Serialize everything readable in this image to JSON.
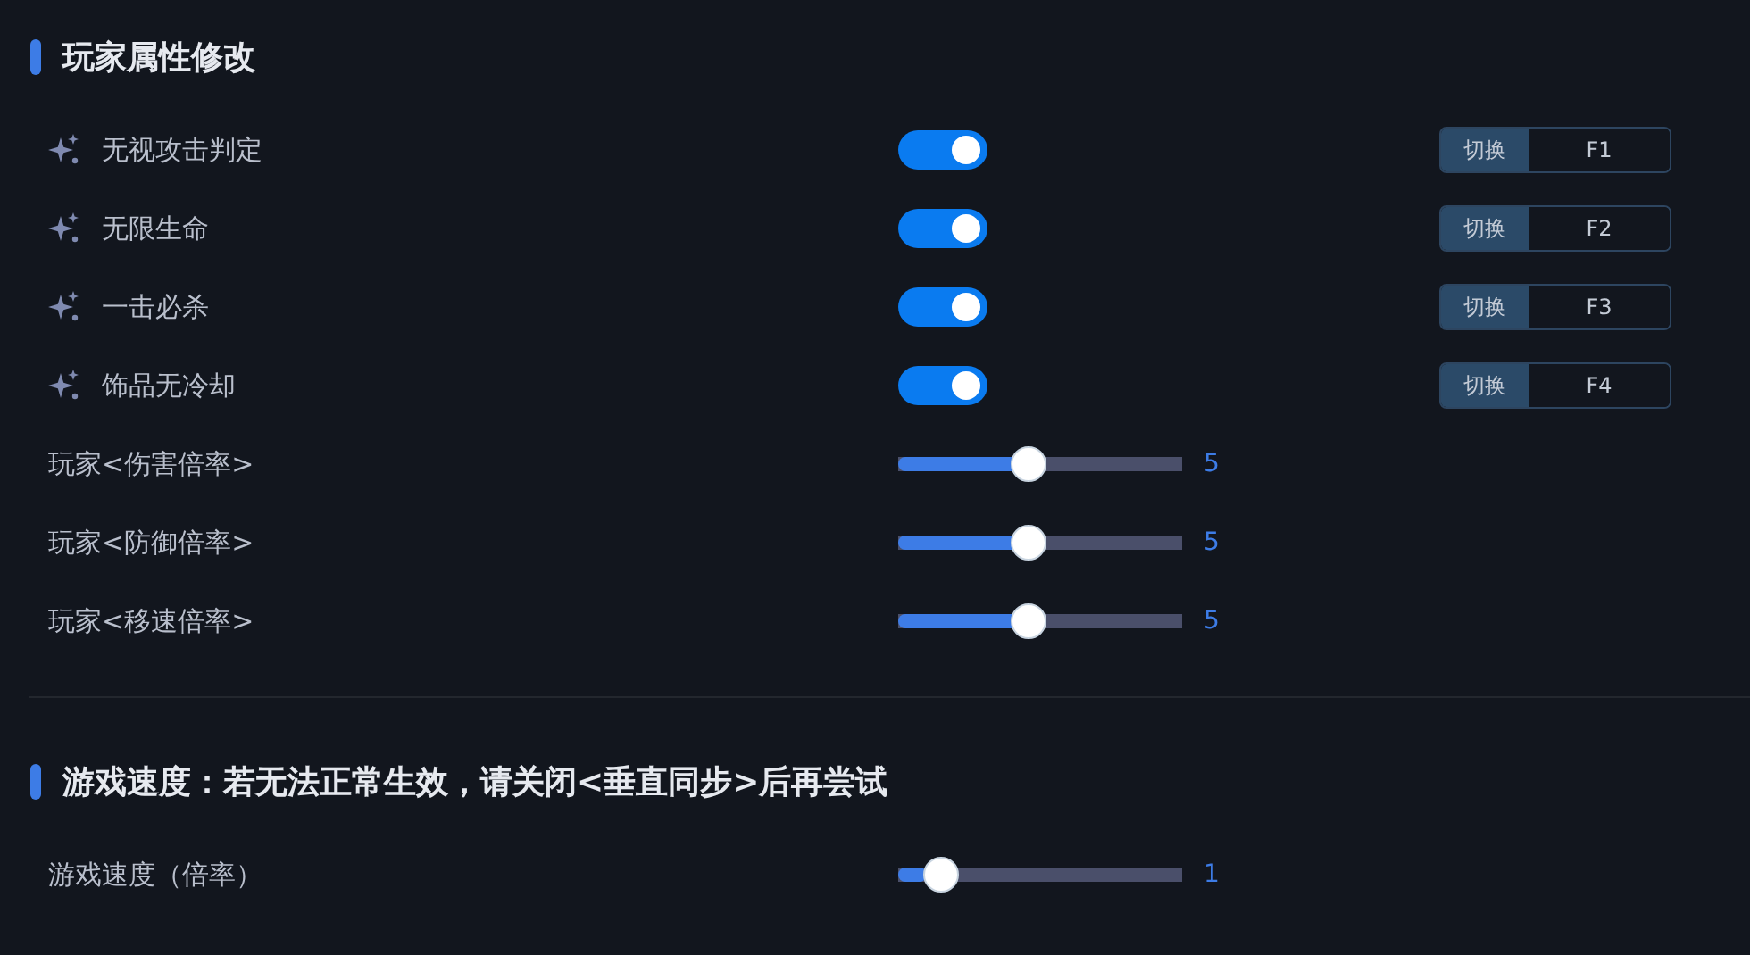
{
  "sections": [
    {
      "title": "玩家属性修改",
      "rows": [
        {
          "kind": "toggle",
          "label": "无视攻击判定",
          "on": true,
          "hotkey": {
            "action": "切换",
            "key": "F1"
          }
        },
        {
          "kind": "toggle",
          "label": "无限生命",
          "on": true,
          "hotkey": {
            "action": "切换",
            "key": "F2"
          }
        },
        {
          "kind": "toggle",
          "label": "一击必杀",
          "on": true,
          "hotkey": {
            "action": "切换",
            "key": "F3"
          }
        },
        {
          "kind": "toggle",
          "label": "饰品无冷却",
          "on": true,
          "hotkey": {
            "action": "切换",
            "key": "F4"
          }
        },
        {
          "kind": "slider",
          "label": "玩家<伤害倍率>",
          "level": 0.45,
          "reading": "5"
        },
        {
          "kind": "slider",
          "label": "玩家<防御倍率>",
          "level": 0.45,
          "reading": "5"
        },
        {
          "kind": "slider",
          "label": "玩家<移速倍率>",
          "level": 0.45,
          "reading": "5"
        }
      ]
    },
    {
      "title": "游戏速度：若无法正常生效，请关闭<垂直同步>后再尝试",
      "rows": [
        {
          "kind": "slider",
          "label": "游戏速度（倍率）",
          "level": 0.1,
          "reading": "1"
        }
      ]
    }
  ]
}
